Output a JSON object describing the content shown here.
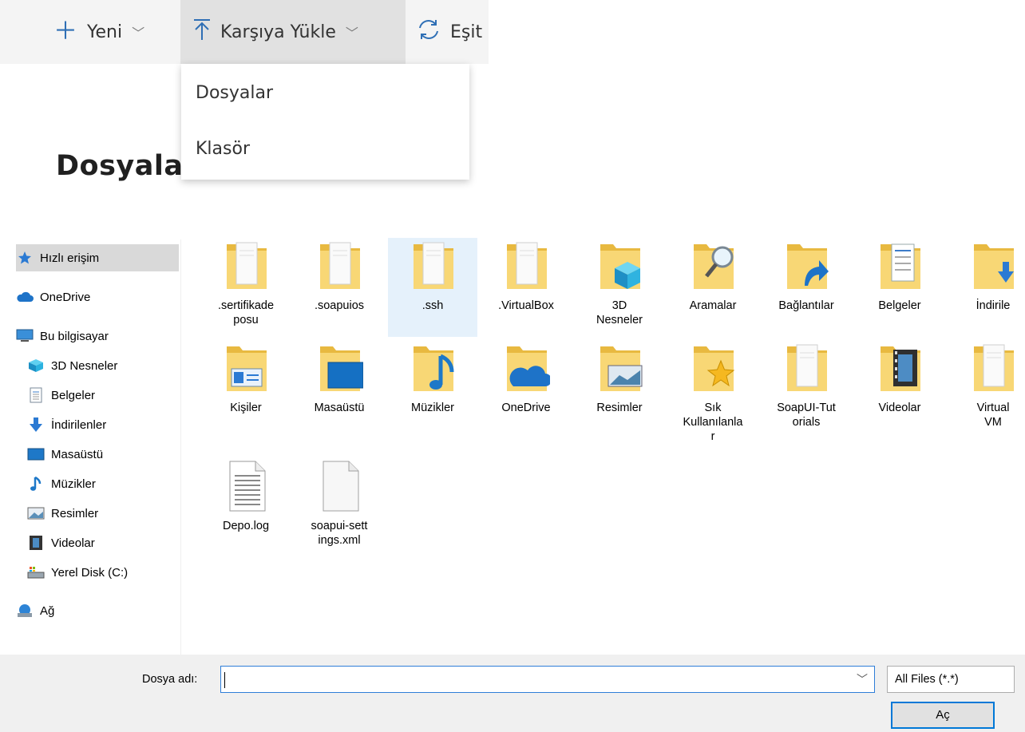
{
  "commandbar": {
    "new_label": "Yeni",
    "upload_label": "Karşıya Yükle",
    "sync_label": "Eşit"
  },
  "upload_menu": {
    "items": [
      {
        "label": "Dosyalar"
      },
      {
        "label": "Klasör"
      }
    ]
  },
  "page": {
    "title": "Dosyalar"
  },
  "navigation": {
    "items": [
      {
        "label": "Hızlı erişim",
        "icon": "star-icon"
      },
      {
        "label": "OneDrive",
        "icon": "cloud-icon"
      },
      {
        "label": "Bu bilgisayar",
        "icon": "computer-icon"
      },
      {
        "label": "3D Nesneler",
        "icon": "cube-icon"
      },
      {
        "label": "Belgeler",
        "icon": "document-icon"
      },
      {
        "label": "İndirilenler",
        "icon": "download-arrow-icon"
      },
      {
        "label": "Masaüstü",
        "icon": "desktop-icon"
      },
      {
        "label": "Müzikler",
        "icon": "music-note-icon"
      },
      {
        "label": "Resimler",
        "icon": "picture-icon"
      },
      {
        "label": "Videolar",
        "icon": "film-icon"
      },
      {
        "label": "Yerel Disk (C:)",
        "icon": "drive-icon"
      },
      {
        "label": "Ağ",
        "icon": "network-icon"
      }
    ]
  },
  "files": {
    "row1": [
      {
        "name": ".sertifikade\nposu",
        "icon": "folder-document-icon"
      },
      {
        "name": ".soapuios",
        "icon": "folder-document-icon"
      },
      {
        "name": ".ssh",
        "icon": "folder-document-icon"
      },
      {
        "name": ".VirtualBox",
        "icon": "folder-document-icon"
      },
      {
        "name": "3D\nNesneler",
        "icon": "folder-cube-icon"
      },
      {
        "name": "Aramalar",
        "icon": "folder-search-icon"
      },
      {
        "name": "Bağlantılar",
        "icon": "folder-link-icon"
      },
      {
        "name": "Belgeler",
        "icon": "folder-documents-icon"
      },
      {
        "name": "İndirile",
        "icon": "folder-download-icon"
      }
    ],
    "row2": [
      {
        "name": "Kişiler",
        "icon": "folder-contacts-icon"
      },
      {
        "name": "Masaüstü",
        "icon": "folder-desktop-icon"
      },
      {
        "name": "Müzikler",
        "icon": "folder-music-icon"
      },
      {
        "name": "OneDrive",
        "icon": "folder-cloud-icon"
      },
      {
        "name": "Resimler",
        "icon": "folder-pictures-icon"
      },
      {
        "name": "Sık\nKullanılanla\nr",
        "icon": "folder-favorites-icon"
      },
      {
        "name": "SoapUI-Tut\norials",
        "icon": "folder-document-icon"
      },
      {
        "name": "Videolar",
        "icon": "folder-video-icon"
      },
      {
        "name": "Virtual\nVM",
        "icon": "folder-document-icon"
      }
    ],
    "row3": [
      {
        "name": "Depo.log",
        "icon": "text-file-icon"
      },
      {
        "name": "soapui-sett\nings.xml",
        "icon": "blank-file-icon"
      }
    ]
  },
  "footer": {
    "filename_label": "Dosya adı:",
    "filename_value": "",
    "filter_value": "All Files (*.*)",
    "open_button": "Aç"
  },
  "colors": {
    "folder": "#f8d775",
    "folder_dark": "#e8b940",
    "accent": "#0078d7",
    "selection": "#e5f1fb"
  }
}
